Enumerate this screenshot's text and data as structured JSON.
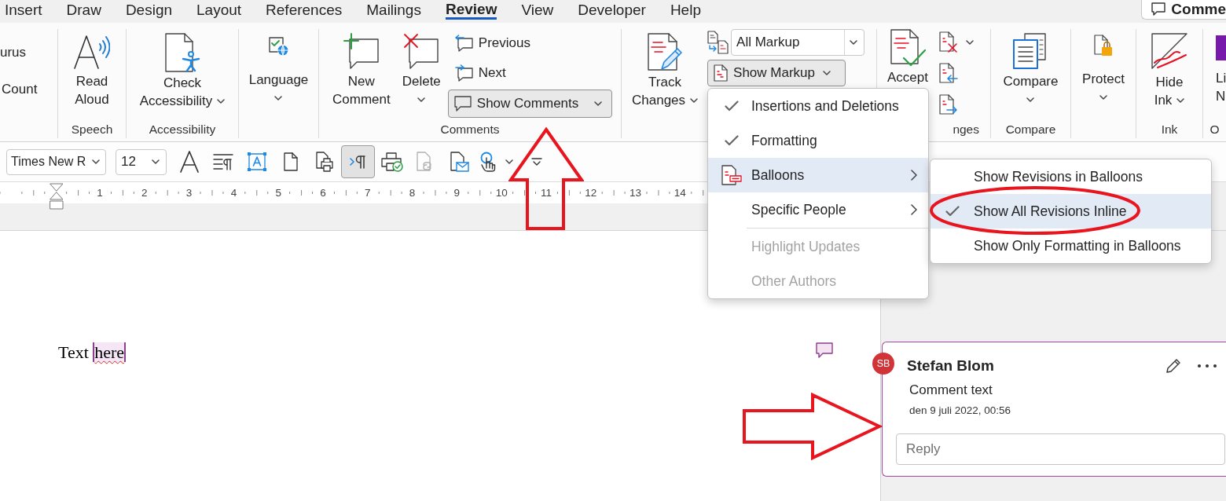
{
  "tabs": [
    {
      "label": "Insert",
      "selected": false
    },
    {
      "label": "Draw",
      "selected": false
    },
    {
      "label": "Design",
      "selected": false
    },
    {
      "label": "Layout",
      "selected": false
    },
    {
      "label": "References",
      "selected": false
    },
    {
      "label": "Mailings",
      "selected": false
    },
    {
      "label": "Review",
      "selected": true
    },
    {
      "label": "View",
      "selected": false
    },
    {
      "label": "Developer",
      "selected": false
    },
    {
      "label": "Help",
      "selected": false
    }
  ],
  "comments_button": {
    "label": "Comme"
  },
  "ribbon": {
    "proofing": {
      "items": [
        "urus",
        "Count"
      ]
    },
    "speech": {
      "label": "Speech",
      "read_aloud": {
        "lines": [
          "Read",
          "Aloud"
        ],
        "dropdown": false
      }
    },
    "accessibility": {
      "label": "Accessibility",
      "check_accessibility": {
        "lines": [
          "Check",
          "Accessibility"
        ],
        "dropdown": true
      }
    },
    "language": {
      "language": {
        "lines": [
          "Language"
        ],
        "dropdown": true
      }
    },
    "comments": {
      "label": "Comments",
      "new_comment": {
        "lines": [
          "New",
          "Comment"
        ],
        "dropdown": false
      },
      "delete": {
        "lines": [
          "Delete"
        ],
        "dropdown": true
      },
      "previous": {
        "label": "Previous"
      },
      "next": {
        "label": "Next"
      },
      "show_comments": {
        "label": "Show Comments",
        "pressed": true,
        "dropdown": true
      }
    },
    "tracking": {
      "track_changes": {
        "lines": [
          "Track",
          "Changes"
        ],
        "dropdown": true
      },
      "markup_view": {
        "value": "All Markup"
      },
      "show_markup": {
        "label": "Show Markup",
        "pressed": true,
        "dropdown": true
      }
    },
    "changes": {
      "label": "nges",
      "accept": {
        "lines": [
          "Accept"
        ],
        "dropdown": false
      },
      "reject": {
        "dropdown": true
      }
    },
    "compare": {
      "label": "Compare",
      "compare": {
        "lines": [
          "Compare"
        ],
        "dropdown": true
      }
    },
    "protect": {
      "protect": {
        "lines": [
          "Protect"
        ],
        "dropdown": true
      }
    },
    "ink": {
      "label": "Ink",
      "hide_ink": {
        "lines": [
          "Hide",
          "Ink"
        ],
        "dropdown": true
      }
    },
    "group_cut": {
      "label": "O",
      "button": {
        "lines": [
          "Li",
          "N"
        ]
      }
    }
  },
  "quick_access": {
    "font": {
      "value": "Times New R"
    },
    "size": {
      "value": "12"
    },
    "buttons": [
      {
        "pressed": false,
        "disabled": false,
        "dropdown": false
      },
      {
        "pressed": false,
        "disabled": false,
        "dropdown": false
      },
      {
        "pressed": false,
        "disabled": false,
        "dropdown": false
      },
      {
        "pressed": false,
        "disabled": false,
        "dropdown": false
      },
      {
        "pressed": false,
        "disabled": false,
        "dropdown": false
      },
      {
        "pressed": true,
        "disabled": false,
        "dropdown": false
      },
      {
        "pressed": false,
        "disabled": false,
        "dropdown": false
      },
      {
        "pressed": false,
        "disabled": true,
        "dropdown": false
      },
      {
        "pressed": false,
        "disabled": false,
        "dropdown": false
      },
      {
        "pressed": false,
        "disabled": false,
        "dropdown": true
      },
      {
        "pressed": false,
        "disabled": false,
        "dropdown": false
      }
    ]
  },
  "ruler": {
    "numbers": [
      "1",
      "2",
      "3",
      "4",
      "5",
      "6",
      "7",
      "8",
      "9",
      "10",
      "11",
      "12",
      "13",
      "14"
    ]
  },
  "document": {
    "runs": [
      {
        "text": "Text",
        "commented": false,
        "misspelled": false
      },
      {
        "text": "here",
        "commented": true,
        "misspelled": true
      }
    ]
  },
  "comment": {
    "initials": "SB",
    "author": "Stefan Blom",
    "text": "Comment text",
    "date": "den 9 juli 2022, 00:56",
    "reply": {
      "placeholder": "Reply"
    }
  },
  "markup_menu": {
    "sections": [
      {
        "items": [
          {
            "label": "Insertions and Deletions",
            "checked": true,
            "icon": false,
            "submenu": false,
            "selected": false,
            "disabled": false
          },
          {
            "label": "Formatting",
            "checked": true,
            "icon": false,
            "submenu": false,
            "selected": false,
            "disabled": false
          },
          {
            "label": "Balloons",
            "checked": false,
            "icon": true,
            "submenu": true,
            "selected": true,
            "disabled": false
          },
          {
            "label": "Specific People",
            "checked": false,
            "icon": false,
            "submenu": true,
            "selected": false,
            "disabled": false
          }
        ]
      },
      {
        "items": [
          {
            "label": "Highlight Updates",
            "checked": false,
            "icon": false,
            "submenu": false,
            "selected": false,
            "disabled": true
          },
          {
            "label": "Other Authors",
            "checked": false,
            "icon": false,
            "submenu": false,
            "selected": false,
            "disabled": true
          }
        ]
      }
    ]
  },
  "balloons_menu": {
    "items": [
      {
        "label": "Show Revisions in Balloons",
        "checked": false,
        "selected": false
      },
      {
        "label": "Show All Revisions Inline",
        "checked": true,
        "selected": true
      },
      {
        "label": "Show Only Formatting in Balloons",
        "checked": false,
        "selected": false
      }
    ]
  },
  "annotations": [
    {
      "kind": "arrow_up"
    },
    {
      "kind": "arrow_right"
    },
    {
      "kind": "ellipse"
    }
  ]
}
